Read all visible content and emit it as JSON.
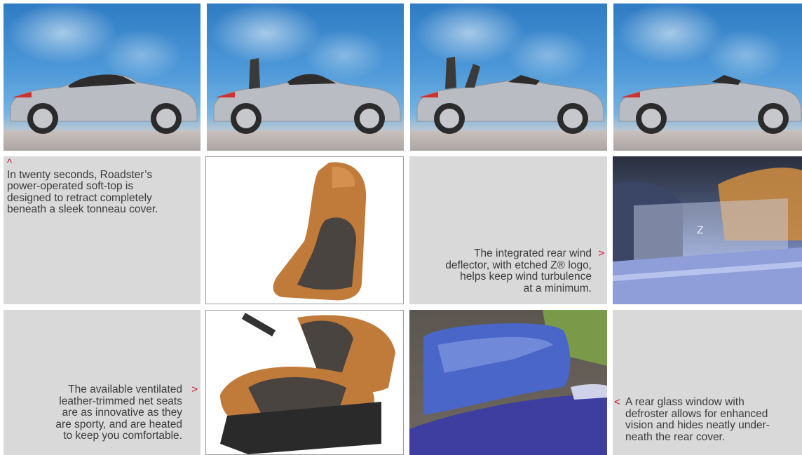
{
  "sequence_photos": [
    {
      "stage": "top-closed"
    },
    {
      "stage": "top-raising"
    },
    {
      "stage": "top-folding"
    },
    {
      "stage": "top-stowed"
    }
  ],
  "captions": {
    "softtop": {
      "marker": "^",
      "lines": [
        "In twenty seconds, Roadster’s",
        "power-operated soft-top is",
        "designed to retract completely",
        "beneath a sleek tonneau cover."
      ]
    },
    "deflector": {
      "marker": ">",
      "lines": [
        "The integrated rear wind",
        "deflector, with etched Z® logo,",
        "helps keep wind turbulence",
        "at a minimum."
      ]
    },
    "seats": {
      "marker": ">",
      "lines": [
        "The available ventilated",
        "leather-trimmed net seats",
        "are as innovative as they",
        "are sporty, and are heated",
        "to keep you comfortable."
      ]
    },
    "window": {
      "marker": "<",
      "lines": [
        "A rear glass window with",
        "defroster allows for enhanced",
        "vision and hides neatly under-",
        "neath the rear cover."
      ]
    }
  },
  "colors": {
    "accent": "#c8102e",
    "panel": "#d9d9d9",
    "text": "#3a3a3a",
    "leather": "#c07a3a"
  }
}
